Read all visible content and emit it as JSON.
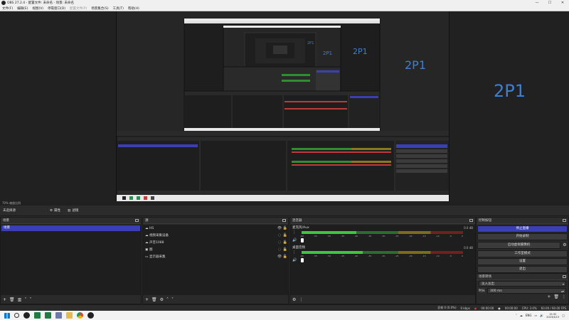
{
  "window": {
    "title": "OBS 27.2.4 - 配置文件: 未命名 - 场景: 未命名"
  },
  "menu": [
    {
      "label": "文件(F)",
      "enabled": true
    },
    {
      "label": "编辑(E)",
      "enabled": true
    },
    {
      "label": "视图(V)",
      "enabled": true
    },
    {
      "label": "停靠窗口(D)",
      "enabled": true
    },
    {
      "label": "配置文件(P)",
      "enabled": false
    },
    {
      "label": "场景集合(S)",
      "enabled": true
    },
    {
      "label": "工具(T)",
      "enabled": true
    },
    {
      "label": "帮助(H)",
      "enabled": true
    }
  ],
  "preview": {
    "labels": [
      "2P1",
      "2P1",
      "2P1",
      "2P1"
    ]
  },
  "status_row": "70%  缩放比例",
  "scene_bar": {
    "current_scene": "未选择源",
    "properties_label": "属性",
    "filters_label": "滤镜"
  },
  "scenes_dock": {
    "title": "场景",
    "items": [
      "场景"
    ]
  },
  "sources_dock": {
    "title": "源",
    "items": [
      {
        "icon": "cloud-icon",
        "name": "HS"
      },
      {
        "icon": "cloud-icon",
        "name": "视频采集设备"
      },
      {
        "icon": "cloud-icon",
        "name": "声音1088"
      },
      {
        "icon": "image-icon",
        "name": "图"
      },
      {
        "icon": "monitor-icon",
        "name": "显示器采集"
      }
    ]
  },
  "mixer_dock": {
    "title": "混音器",
    "tracks": [
      {
        "name": "麦克风/Aux",
        "db": "0.0 dB",
        "level": 0.34
      },
      {
        "name": "桌面音频",
        "db": "0.0 dB",
        "level": 0.38
      }
    ],
    "ticks": [
      "-60",
      "-55",
      "-50",
      "-45",
      "-40",
      "-35",
      "-30",
      "-25",
      "-20",
      "-15",
      "-10",
      "-5",
      "0"
    ]
  },
  "controls_dock": {
    "title": "控制按钮",
    "buttons": [
      {
        "label": "停止直播",
        "active": true
      },
      {
        "label": "开始录制",
        "active": false
      },
      {
        "label": "启动虚拟摄像机",
        "active": false
      },
      {
        "label": "工作室模式",
        "active": false
      },
      {
        "label": "设置",
        "active": false
      },
      {
        "label": "退出",
        "active": false
      }
    ]
  },
  "transitions_dock": {
    "title": "场景转场",
    "transition": "淡入淡出",
    "duration_label": "时长",
    "duration": "300 ms"
  },
  "bottom_status": {
    "dropped": "丢帧 0 (0.0%)",
    "bitrate": "0 kbps",
    "live_time": "00:00:00",
    "rec_time": "00:00:00",
    "cpu": "CPU: 3.0%",
    "fps": "60.00 / 60.00 FPS"
  },
  "taskbar": {
    "lang": "ENG",
    "time": "15:32",
    "date": "2023/4/13"
  },
  "colors": {
    "accent": "#3a3fb3",
    "label_blue": "#3f7fd0"
  }
}
